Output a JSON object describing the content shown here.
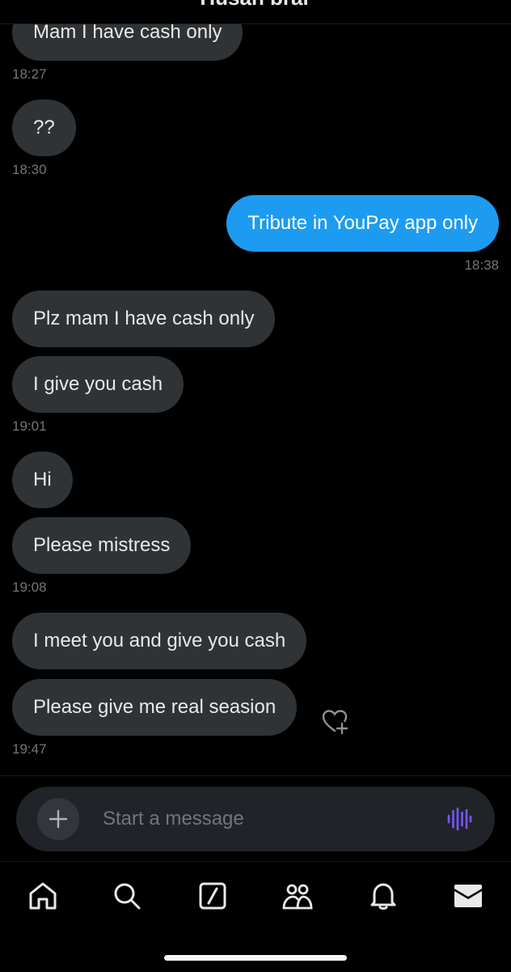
{
  "header": {
    "name": "Husan brar"
  },
  "messages": [
    {
      "text": "Mam I have cash only",
      "direction": "received"
    },
    {
      "text": "??",
      "direction": "received"
    },
    {
      "text": "Tribute in YouPay app only",
      "direction": "sent"
    },
    {
      "text": "Plz mam I have cash only",
      "direction": "received"
    },
    {
      "text": "I give you cash",
      "direction": "received"
    },
    {
      "text": "Hi",
      "direction": "received"
    },
    {
      "text": "Please mistress",
      "direction": "received"
    },
    {
      "text": "I meet you and give you cash",
      "direction": "received"
    },
    {
      "text": "Please give me real seasion",
      "direction": "received"
    }
  ],
  "timestamps": [
    "18:27",
    "18:30",
    "18:38",
    "19:01",
    "19:08",
    "19:47"
  ],
  "composer": {
    "placeholder": "Start a message"
  },
  "icons": {
    "react": "heart-plus-icon",
    "add": "plus-icon",
    "voice": "voice-waveform-icon",
    "tabs": [
      "home-icon",
      "search-icon",
      "grok-icon",
      "communities-icon",
      "notifications-icon",
      "messages-icon"
    ]
  },
  "colors": {
    "background": "#000000",
    "received_bubble": "#2f3336",
    "sent_bubble": "#1d9bf0",
    "timestamp": "#71767b",
    "voice_accent": "#7856ff"
  }
}
